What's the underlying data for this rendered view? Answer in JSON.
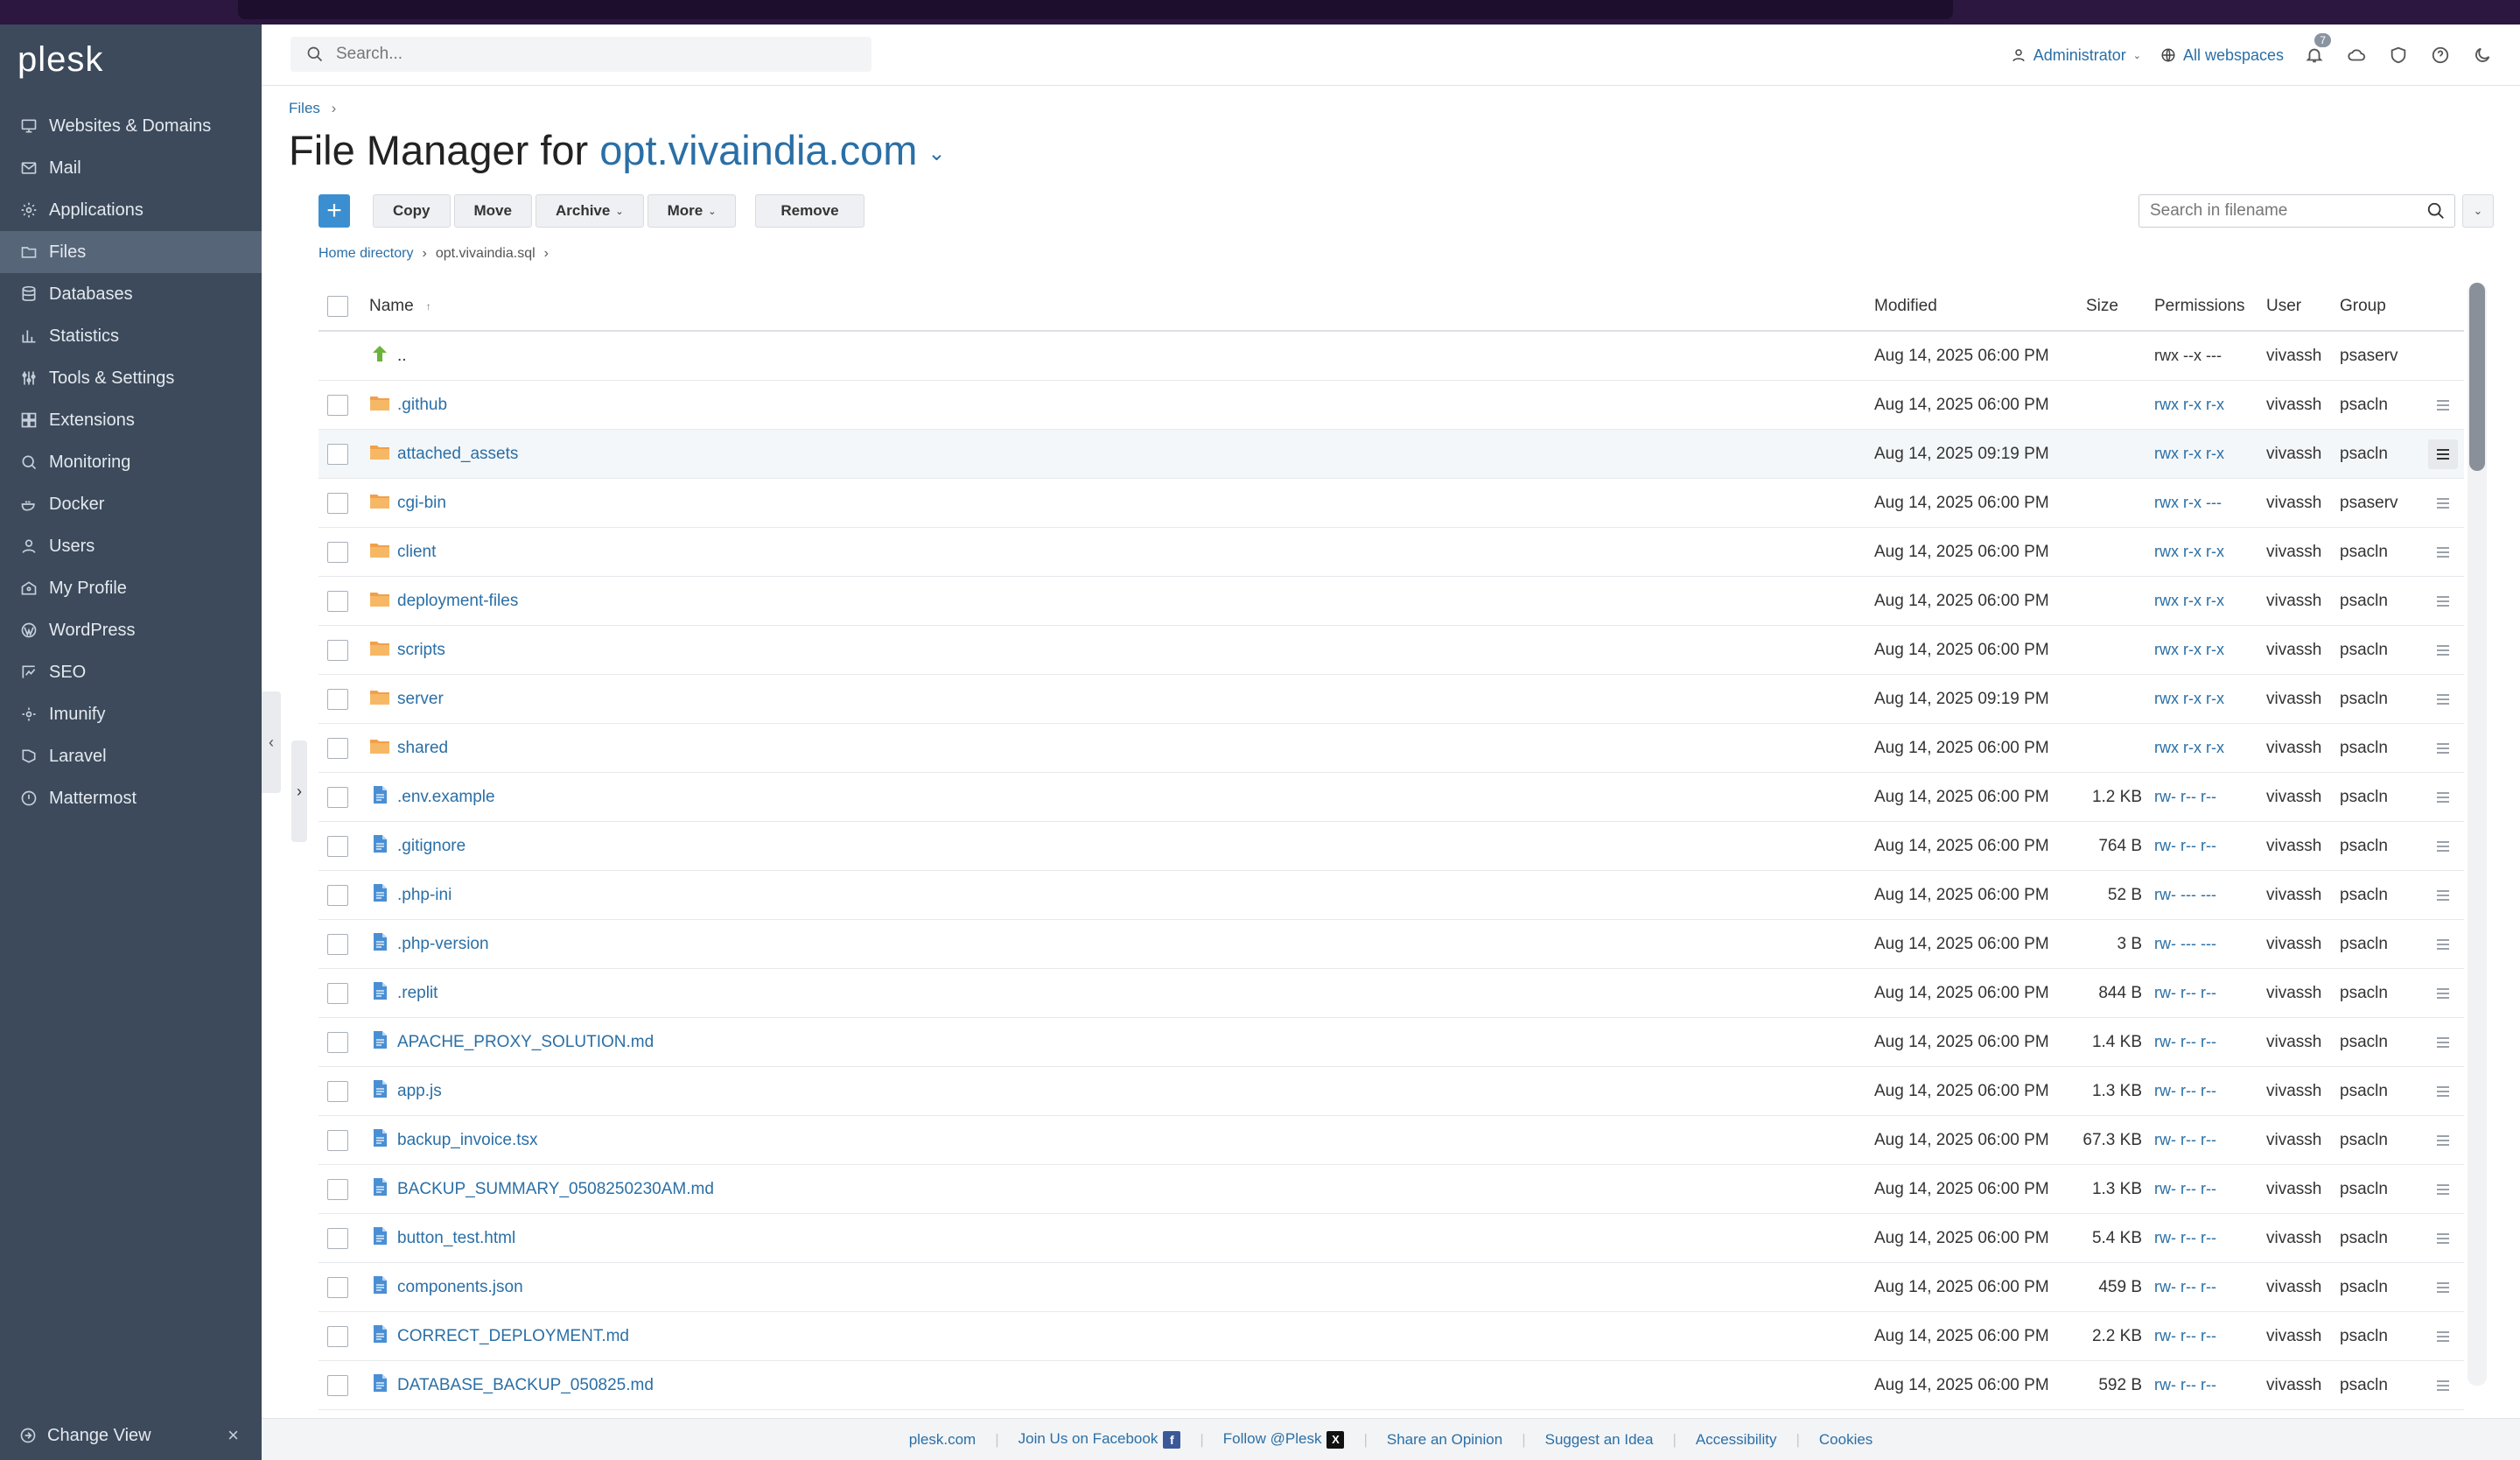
{
  "app": {
    "logo": "plesk"
  },
  "sidebar": {
    "items": [
      {
        "label": "Websites & Domains",
        "icon": "monitor-icon"
      },
      {
        "label": "Mail",
        "icon": "mail-icon"
      },
      {
        "label": "Applications",
        "icon": "gear-icon"
      },
      {
        "label": "Files",
        "icon": "folder-icon",
        "active": true
      },
      {
        "label": "Databases",
        "icon": "database-icon"
      },
      {
        "label": "Statistics",
        "icon": "bar-chart-icon"
      },
      {
        "label": "Tools & Settings",
        "icon": "sliders-icon"
      },
      {
        "label": "Extensions",
        "icon": "extensions-icon"
      },
      {
        "label": "Monitoring",
        "icon": "monitoring-icon"
      },
      {
        "label": "Docker",
        "icon": "docker-icon"
      },
      {
        "label": "Users",
        "icon": "user-icon"
      },
      {
        "label": "My Profile",
        "icon": "profile-icon"
      },
      {
        "label": "WordPress",
        "icon": "wordpress-icon"
      },
      {
        "label": "SEO",
        "icon": "seo-icon"
      },
      {
        "label": "Imunify",
        "icon": "imunify-icon"
      },
      {
        "label": "Laravel",
        "icon": "laravel-icon"
      },
      {
        "label": "Mattermost",
        "icon": "mattermost-icon"
      }
    ],
    "change_view": "Change View"
  },
  "header": {
    "search_placeholder": "Search...",
    "user": "Administrator",
    "webspaces": "All webspaces",
    "notifications_count": "7"
  },
  "breadcrumb": {
    "files": "Files"
  },
  "title": {
    "prefix": "File Manager for",
    "domain": "opt.vivaindia.com"
  },
  "toolbar": {
    "add": "+",
    "copy": "Copy",
    "move": "Move",
    "archive": "Archive",
    "more": "More",
    "remove": "Remove",
    "filename_search_placeholder": "Search in filename"
  },
  "path": {
    "home": "Home directory",
    "current": "opt.vivaindia.sql"
  },
  "table": {
    "headers": {
      "name": "Name",
      "modified": "Modified",
      "size": "Size",
      "permissions": "Permissions",
      "user": "User",
      "group": "Group"
    },
    "rows": [
      {
        "name": "..",
        "type": "up",
        "modified": "Aug 14, 2025 06:00 PM",
        "size": "",
        "perms": "rwx --x ---",
        "user": "vivassh",
        "group": "psaserv"
      },
      {
        "name": ".github",
        "type": "folder",
        "modified": "Aug 14, 2025 06:00 PM",
        "size": "",
        "perms": "rwx r-x r-x",
        "user": "vivassh",
        "group": "psacln"
      },
      {
        "name": "attached_assets",
        "type": "folder",
        "modified": "Aug 14, 2025 09:19 PM",
        "size": "",
        "perms": "rwx r-x r-x",
        "user": "vivassh",
        "group": "psacln"
      },
      {
        "name": "cgi-bin",
        "type": "folder",
        "modified": "Aug 14, 2025 06:00 PM",
        "size": "",
        "perms": "rwx r-x ---",
        "user": "vivassh",
        "group": "psaserv"
      },
      {
        "name": "client",
        "type": "folder",
        "modified": "Aug 14, 2025 06:00 PM",
        "size": "",
        "perms": "rwx r-x r-x",
        "user": "vivassh",
        "group": "psacln"
      },
      {
        "name": "deployment-files",
        "type": "folder",
        "modified": "Aug 14, 2025 06:00 PM",
        "size": "",
        "perms": "rwx r-x r-x",
        "user": "vivassh",
        "group": "psacln"
      },
      {
        "name": "scripts",
        "type": "folder",
        "modified": "Aug 14, 2025 06:00 PM",
        "size": "",
        "perms": "rwx r-x r-x",
        "user": "vivassh",
        "group": "psacln"
      },
      {
        "name": "server",
        "type": "folder",
        "modified": "Aug 14, 2025 09:19 PM",
        "size": "",
        "perms": "rwx r-x r-x",
        "user": "vivassh",
        "group": "psacln"
      },
      {
        "name": "shared",
        "type": "folder",
        "modified": "Aug 14, 2025 06:00 PM",
        "size": "",
        "perms": "rwx r-x r-x",
        "user": "vivassh",
        "group": "psacln"
      },
      {
        "name": ".env.example",
        "type": "file",
        "modified": "Aug 14, 2025 06:00 PM",
        "size": "1.2 KB",
        "perms": "rw- r-- r--",
        "user": "vivassh",
        "group": "psacln"
      },
      {
        "name": ".gitignore",
        "type": "file",
        "modified": "Aug 14, 2025 06:00 PM",
        "size": "764 B",
        "perms": "rw- r-- r--",
        "user": "vivassh",
        "group": "psacln"
      },
      {
        "name": ".php-ini",
        "type": "file",
        "modified": "Aug 14, 2025 06:00 PM",
        "size": "52 B",
        "perms": "rw- --- ---",
        "user": "vivassh",
        "group": "psacln"
      },
      {
        "name": ".php-version",
        "type": "file",
        "modified": "Aug 14, 2025 06:00 PM",
        "size": "3 B",
        "perms": "rw- --- ---",
        "user": "vivassh",
        "group": "psacln"
      },
      {
        "name": ".replit",
        "type": "file",
        "modified": "Aug 14, 2025 06:00 PM",
        "size": "844 B",
        "perms": "rw- r-- r--",
        "user": "vivassh",
        "group": "psacln"
      },
      {
        "name": "APACHE_PROXY_SOLUTION.md",
        "type": "file",
        "modified": "Aug 14, 2025 06:00 PM",
        "size": "1.4 KB",
        "perms": "rw- r-- r--",
        "user": "vivassh",
        "group": "psacln"
      },
      {
        "name": "app.js",
        "type": "file",
        "modified": "Aug 14, 2025 06:00 PM",
        "size": "1.3 KB",
        "perms": "rw- r-- r--",
        "user": "vivassh",
        "group": "psacln"
      },
      {
        "name": "backup_invoice.tsx",
        "type": "file",
        "modified": "Aug 14, 2025 06:00 PM",
        "size": "67.3 KB",
        "perms": "rw- r-- r--",
        "user": "vivassh",
        "group": "psacln"
      },
      {
        "name": "BACKUP_SUMMARY_0508250230AM.md",
        "type": "file",
        "modified": "Aug 14, 2025 06:00 PM",
        "size": "1.3 KB",
        "perms": "rw- r-- r--",
        "user": "vivassh",
        "group": "psacln"
      },
      {
        "name": "button_test.html",
        "type": "file",
        "modified": "Aug 14, 2025 06:00 PM",
        "size": "5.4 KB",
        "perms": "rw- r-- r--",
        "user": "vivassh",
        "group": "psacln"
      },
      {
        "name": "components.json",
        "type": "file",
        "modified": "Aug 14, 2025 06:00 PM",
        "size": "459 B",
        "perms": "rw- r-- r--",
        "user": "vivassh",
        "group": "psacln"
      },
      {
        "name": "CORRECT_DEPLOYMENT.md",
        "type": "file",
        "modified": "Aug 14, 2025 06:00 PM",
        "size": "2.2 KB",
        "perms": "rw- r-- r--",
        "user": "vivassh",
        "group": "psacln"
      },
      {
        "name": "DATABASE_BACKUP_050825.md",
        "type": "file",
        "modified": "Aug 14, 2025 06:00 PM",
        "size": "592 B",
        "perms": "rw- r-- r--",
        "user": "vivassh",
        "group": "psacln"
      }
    ]
  },
  "footer": {
    "links": [
      "plesk.com",
      "Join Us on Facebook",
      "Follow @Plesk",
      "Share an Opinion",
      "Suggest an Idea",
      "Accessibility",
      "Cookies"
    ]
  },
  "colors": {
    "sidebar": "#3c4a5b",
    "accent": "#2a6fa6",
    "folder": "#f0a04b",
    "file": "#4a8fd4"
  }
}
